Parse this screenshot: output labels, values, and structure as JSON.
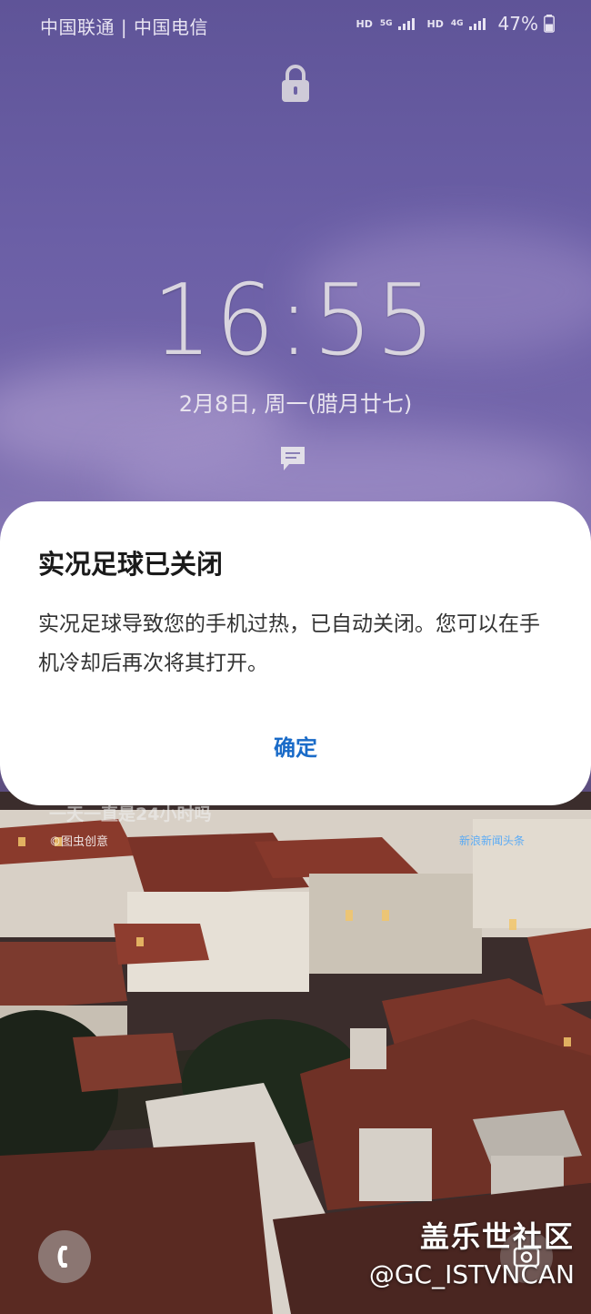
{
  "status_bar": {
    "carriers": "中国联通 | 中国电信",
    "sim1_hd": "HD",
    "sim1_network": "5G",
    "sim2_hd": "HD",
    "sim2_network": "4G",
    "battery": "47%",
    "battery_icon": "battery-icon",
    "signal_icon": "signal-bars-icon"
  },
  "lockscreen": {
    "lock_icon": "lock-icon",
    "time": "16:55",
    "date": "2月8日, 周一(腊月廿七)",
    "message_icon": "message-bubble-icon"
  },
  "dialog": {
    "title": "实况足球已关闭",
    "body": "实况足球导致您的手机过热，已自动关闭。您可以在手机冷却后再次将其打开。",
    "ok_label": "确定",
    "accent_color": "#1a6bc8"
  },
  "wallpaper_text": {
    "overlay": "一天一直是24小时吗",
    "credit": "©图虫创意",
    "blue_tag": "新浪新闻头条"
  },
  "shortcuts": {
    "phone_icon": "phone-icon",
    "camera_icon": "camera-icon"
  },
  "watermark": {
    "title": "盖乐世社区",
    "handle": "@GC_ISTVNCAN"
  }
}
